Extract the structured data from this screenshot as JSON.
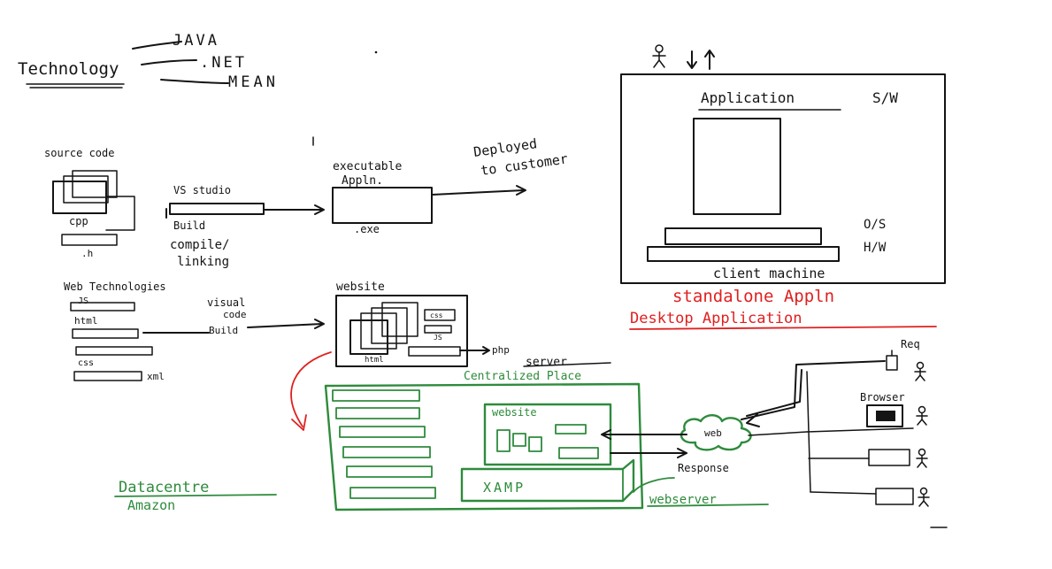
{
  "colors": {
    "ink": "#141414",
    "green": "#2e8b3c",
    "red": "#e02020",
    "background": "#ffffff"
  },
  "technology": {
    "label": "Technology",
    "options": [
      "JAVA",
      ".NET",
      "MEAN"
    ]
  },
  "desktop_flow": {
    "source_code": "source code",
    "cpp": "cpp",
    "h": ".h",
    "vs_studio": "VS studio",
    "build": "Build",
    "compile_linking": [
      "compile/",
      "linking"
    ],
    "executable": [
      "executable",
      "Appln."
    ],
    "exe": ".exe",
    "deployed": [
      "Deployed",
      "to customer"
    ]
  },
  "client_machine": {
    "application": "Application",
    "sw": "S/W",
    "os": "O/S",
    "hw": "H/W",
    "client": "client machine",
    "standalone": "standalone Appln",
    "desktop": "Desktop Application"
  },
  "web_flow": {
    "web_technologies": "Web Technologies",
    "files": [
      "JS",
      "html",
      "css",
      "xml"
    ],
    "visual_code": [
      "visual",
      "code",
      "Build"
    ],
    "website": "website",
    "website_inner": {
      "css": "css",
      "js": "JS",
      "html": "html"
    },
    "php": "php"
  },
  "server": {
    "server": "server",
    "centralized": "Centralized Place",
    "website": "website",
    "xamp": "XAMP",
    "datacentre": "Datacentre",
    "amazon": "Amazon",
    "webserver": "webserver",
    "web": "web",
    "response": "Response",
    "request": "Req",
    "browser": "Browser"
  }
}
